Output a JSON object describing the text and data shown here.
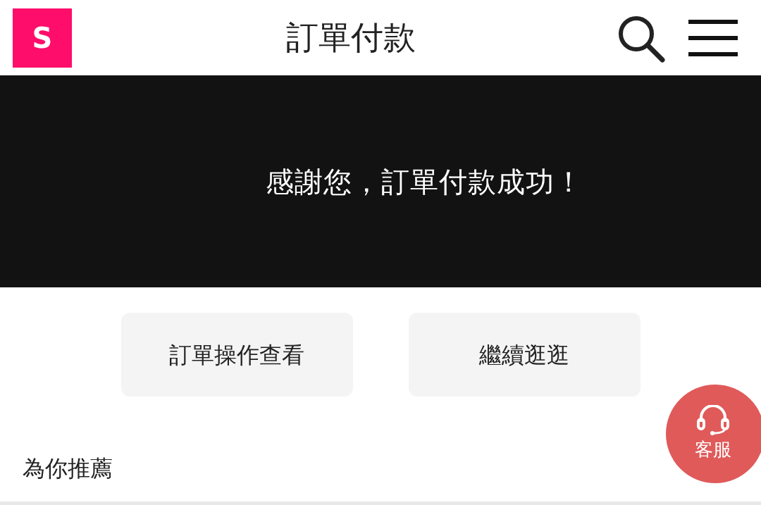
{
  "header": {
    "logo": "S",
    "title": "訂單付款"
  },
  "banner": {
    "message": "感謝您，訂單付款成功！"
  },
  "buttons": [
    "訂單操作查看",
    "繼續逛逛"
  ],
  "recommend": {
    "title": "為你推薦"
  },
  "support": {
    "label": "客服"
  }
}
